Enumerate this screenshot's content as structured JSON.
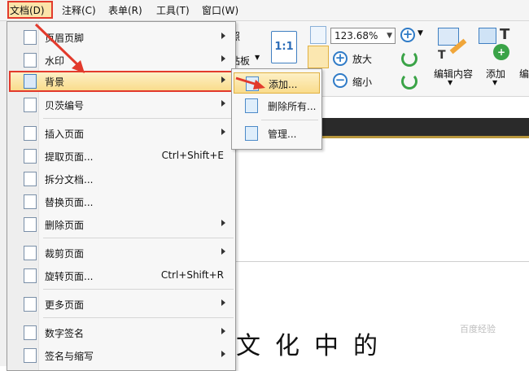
{
  "menubar": {
    "items": [
      "文档(D)",
      "注释(C)",
      "表单(R)",
      "工具(T)",
      "窗口(W)"
    ]
  },
  "ribbon": {
    "partial_label_photo": "照",
    "partial_label_board": "粘板",
    "fit_label": "1:1",
    "zoom_value": "123.68%",
    "zoom_in_label": "放大",
    "zoom_out_label": "缩小",
    "edit_content_label": "编辑内容",
    "add_label": "添加",
    "partial_edit_label": "编"
  },
  "doc_menu": {
    "items": [
      {
        "label": "页眉页脚",
        "shortcut": "",
        "submenu": true
      },
      {
        "label": "水印",
        "shortcut": "",
        "submenu": true
      },
      {
        "label": "背景",
        "shortcut": "",
        "submenu": true
      },
      {
        "label": "贝茨编号",
        "shortcut": "",
        "submenu": true
      },
      {
        "label": "插入页面",
        "shortcut": "",
        "submenu": true
      },
      {
        "label": "提取页面...",
        "shortcut": "Ctrl+Shift+E",
        "submenu": false
      },
      {
        "label": "拆分文档...",
        "shortcut": "",
        "submenu": false
      },
      {
        "label": "替换页面...",
        "shortcut": "",
        "submenu": false
      },
      {
        "label": "删除页面",
        "shortcut": "",
        "submenu": true
      },
      {
        "label": "裁剪页面",
        "shortcut": "",
        "submenu": true
      },
      {
        "label": "旋转页面...",
        "shortcut": "Ctrl+Shift+R",
        "submenu": false
      },
      {
        "label": "更多页面",
        "shortcut": "",
        "submenu": true
      },
      {
        "label": "数字签名",
        "shortcut": "",
        "submenu": true
      },
      {
        "label": "签名与缩写",
        "shortcut": "",
        "submenu": true
      }
    ]
  },
  "background_submenu": {
    "items": [
      "添加...",
      "删除所有...",
      "管理..."
    ]
  },
  "document": {
    "calligraphy_text": "文化中的",
    "watermark_text": "百度经验"
  },
  "colors": {
    "highlight_border": "#e23a2c",
    "highlight_fill": "#f9dc8c",
    "accent_blue": "#2f7bc7",
    "green": "#3aa347"
  }
}
